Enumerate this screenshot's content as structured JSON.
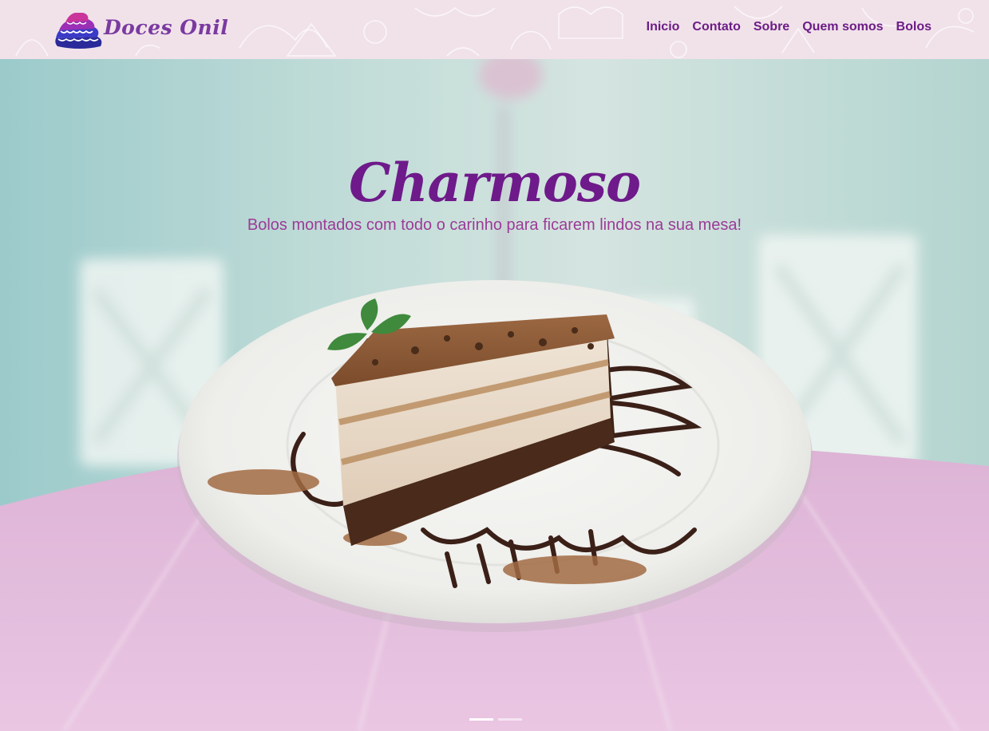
{
  "brand": {
    "name": "Doces Onil"
  },
  "nav": {
    "items": [
      {
        "label": "Inicio"
      },
      {
        "label": "Contato"
      },
      {
        "label": "Sobre"
      },
      {
        "label": "Quem somos"
      },
      {
        "label": "Bolos"
      }
    ]
  },
  "hero": {
    "title": "Charmoso",
    "subtitle": "Bolos montados com todo o carinho para ficarem lindos na sua mesa!",
    "slide_count": 2,
    "active_slide": 1
  },
  "colors": {
    "brand_purple": "#6e1a8a",
    "subtitle_pink": "#9c3b97",
    "header_bg": "#f1e2ea"
  }
}
